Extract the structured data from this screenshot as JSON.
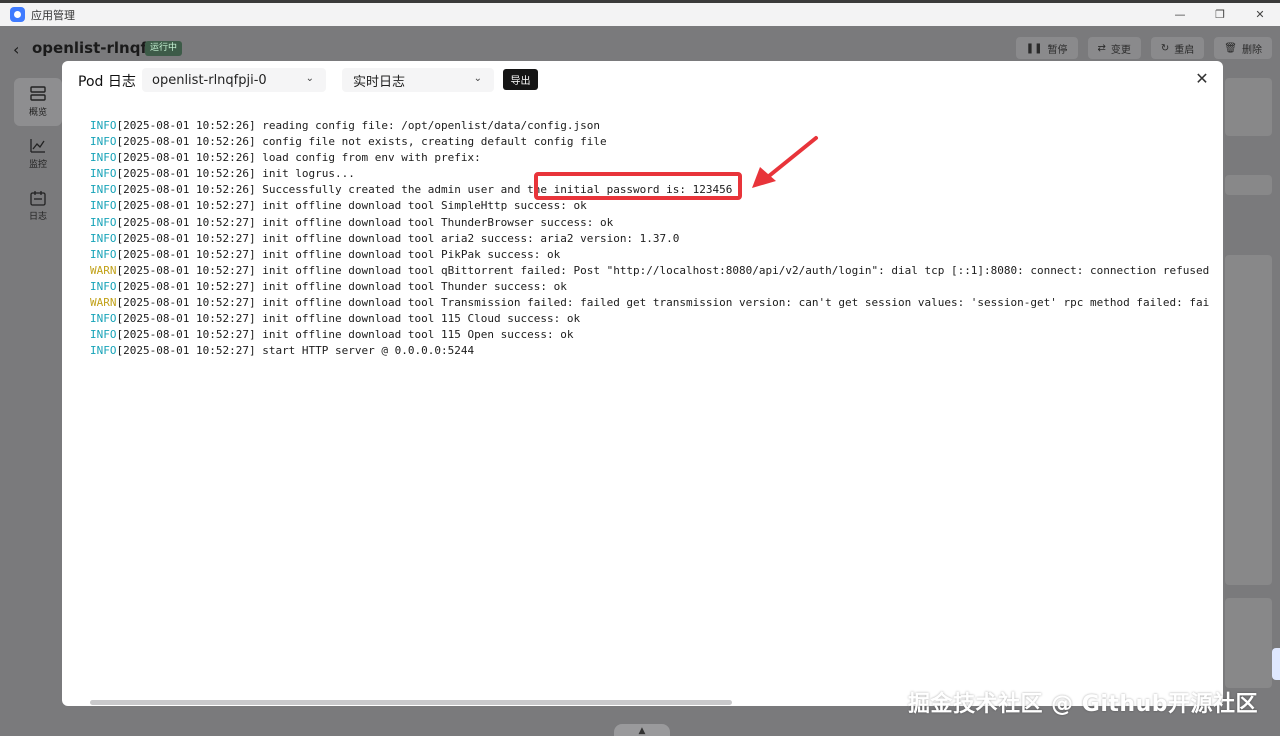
{
  "window": {
    "title": "应用管理",
    "controls": [
      "—",
      "❐",
      "✕"
    ]
  },
  "background": {
    "app_name": "openlist-rlnqfpji",
    "status": "运行中",
    "actions": [
      {
        "icon": "pause-icon",
        "glyph": "❚❚",
        "label": "暂停"
      },
      {
        "icon": "swap-icon",
        "glyph": "⇄",
        "label": "变更"
      },
      {
        "icon": "restart-icon",
        "glyph": "↻",
        "label": "重启"
      },
      {
        "icon": "trash-icon",
        "glyph": "🗑",
        "label": "删除"
      }
    ],
    "sidebar": [
      {
        "icon": "overview-icon",
        "label": "概览"
      },
      {
        "icon": "monitor-icon",
        "label": "监控"
      },
      {
        "icon": "log-icon",
        "label": "日志"
      }
    ]
  },
  "modal": {
    "title": "Pod 日志",
    "pod_select": "openlist-rlnqfpji-0",
    "mode_select": "实时日志",
    "export_label": "导出",
    "close_glyph": "✕",
    "logs": [
      {
        "level": "INFO",
        "text": "[2025-08-01 10:52:26] reading config file: /opt/openlist/data/config.json"
      },
      {
        "level": "INFO",
        "text": "[2025-08-01 10:52:26] config file not exists, creating default config file"
      },
      {
        "level": "INFO",
        "text": "[2025-08-01 10:52:26] load config from env with prefix:"
      },
      {
        "level": "INFO",
        "text": "[2025-08-01 10:52:26] init logrus..."
      },
      {
        "level": "INFO",
        "text": "[2025-08-01 10:52:26] Successfully created the admin user and the initial password is: 123456"
      },
      {
        "level": "INFO",
        "text": "[2025-08-01 10:52:27] init offline download tool SimpleHttp success: ok"
      },
      {
        "level": "INFO",
        "text": "[2025-08-01 10:52:27] init offline download tool ThunderBrowser success: ok"
      },
      {
        "level": "INFO",
        "text": "[2025-08-01 10:52:27] init offline download tool aria2 success: aria2 version: 1.37.0"
      },
      {
        "level": "INFO",
        "text": "[2025-08-01 10:52:27] init offline download tool PikPak success: ok"
      },
      {
        "level": "WARN",
        "text": "[2025-08-01 10:52:27] init offline download tool qBittorrent failed: Post \"http://localhost:8080/api/v2/auth/login\": dial tcp [::1]:8080: connect: connection refused"
      },
      {
        "level": "INFO",
        "text": "[2025-08-01 10:52:27] init offline download tool Thunder success: ok"
      },
      {
        "level": "WARN",
        "text": "[2025-08-01 10:52:27] init offline download tool Transmission failed: failed get transmission version: can't get session values: 'session-get' rpc method failed: faile"
      },
      {
        "level": "INFO",
        "text": "[2025-08-01 10:52:27] init offline download tool 115 Cloud success: ok"
      },
      {
        "level": "INFO",
        "text": "[2025-08-01 10:52:27] init offline download tool 115 Open success: ok"
      },
      {
        "level": "INFO",
        "text": "[2025-08-01 10:52:27] start HTTP server @ 0.0.0.0:5244"
      }
    ]
  },
  "colors": {
    "info": "#17a3b8",
    "warn": "#c2a21a",
    "annotation": "#e8343a"
  },
  "watermark": "掘金技术社区 @ Github开源社区"
}
